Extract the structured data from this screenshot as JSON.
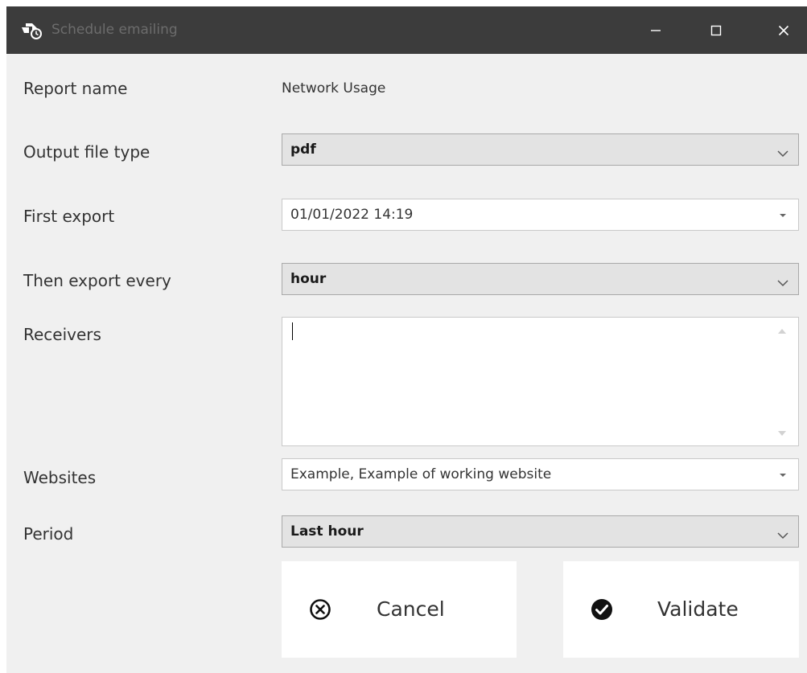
{
  "window": {
    "title": "Schedule emailing",
    "icons": {
      "app": "schedule-clock-icon",
      "minimize": "minimize-icon",
      "maximize": "maximize-icon",
      "close": "close-icon"
    },
    "titlebar_color": "#3c3c3c"
  },
  "form": {
    "report_name": {
      "label": "Report name",
      "value": "Network Usage"
    },
    "output_file_type": {
      "label": "Output file type",
      "selected": "pdf"
    },
    "first_export": {
      "label": "First export",
      "value": "01/01/2022 14:19"
    },
    "then_export_every": {
      "label": "Then export every",
      "selected": "hour"
    },
    "receivers": {
      "label": "Receivers",
      "value": ""
    },
    "websites": {
      "label": "Websites",
      "value": "Example, Example of working website"
    },
    "period": {
      "label": "Period",
      "selected": "Last hour"
    }
  },
  "buttons": {
    "cancel": {
      "label": "Cancel",
      "icon": "circle-x-icon"
    },
    "validate": {
      "label": "Validate",
      "icon": "check-circle-icon"
    }
  }
}
